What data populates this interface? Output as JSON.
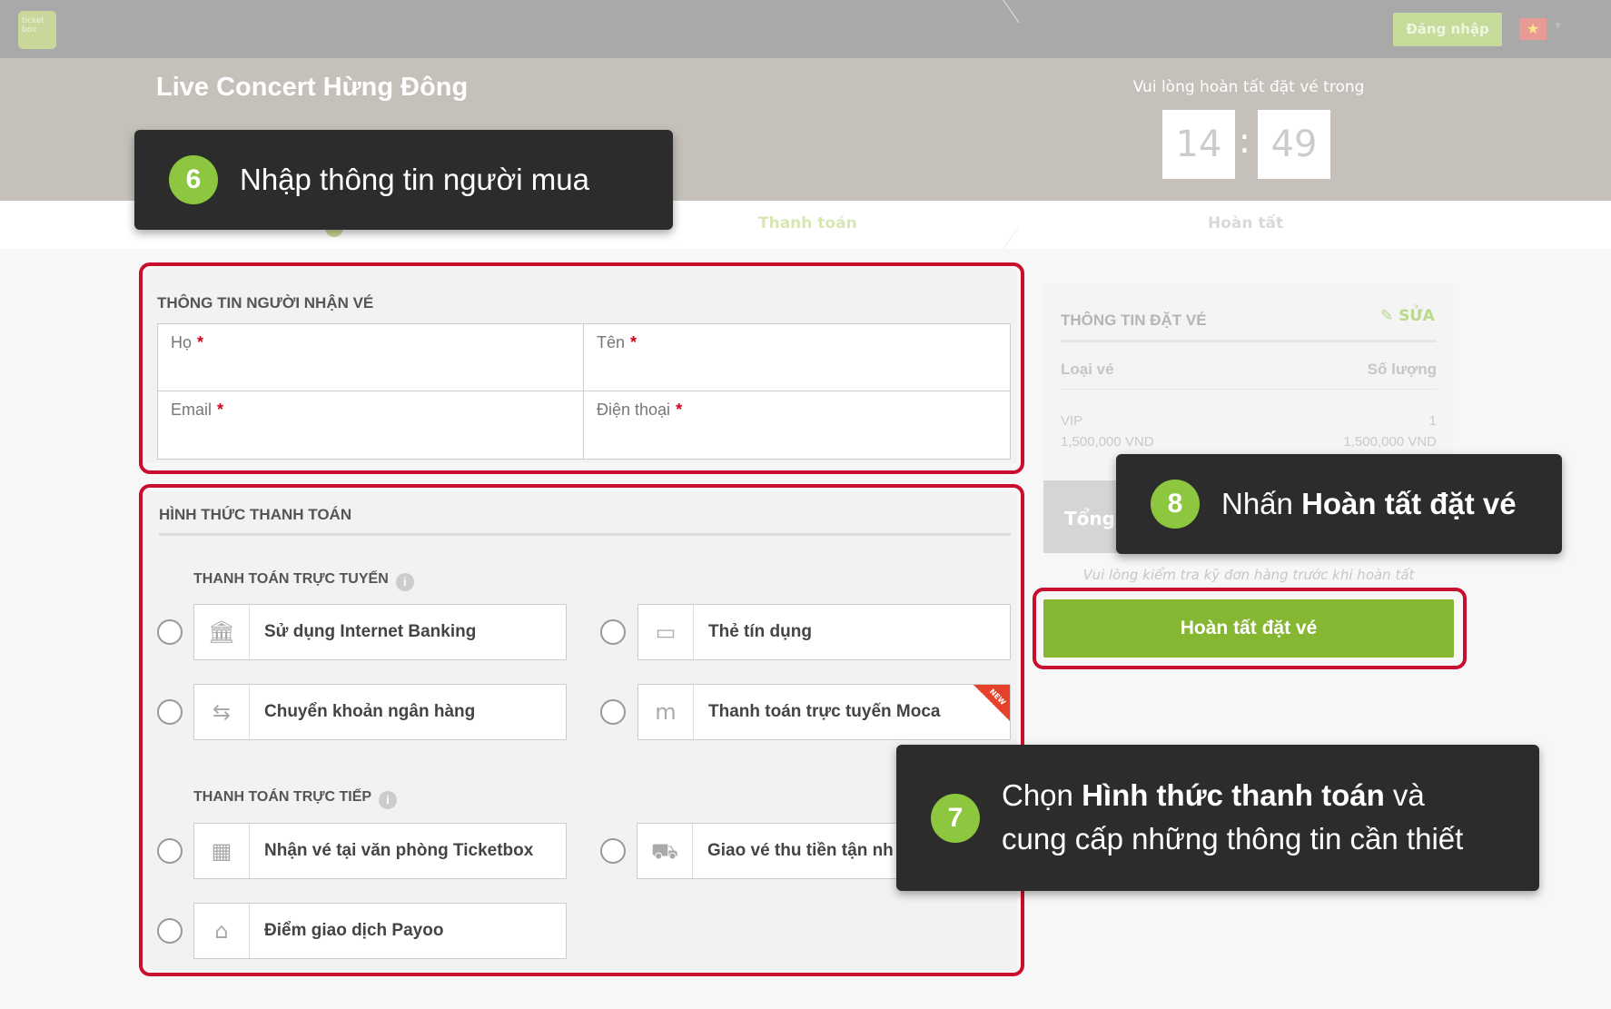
{
  "navbar": {
    "logo_text": "ticket box",
    "login_label": "Đăng nhập",
    "flag_icon": "vietnam-flag",
    "flag_symbol": "★"
  },
  "event": {
    "title": "Live Concert Hừng Đông",
    "timer_label": "Vui lòng hoàn tất đặt vé trong",
    "minutes": "14",
    "separator": ":",
    "seconds": "49"
  },
  "steps": [
    {
      "label": "Thanh toán"
    },
    {
      "label": "Hoàn tất"
    }
  ],
  "receiver": {
    "title": "THÔNG TIN NGƯỜI NHẬN VÉ",
    "fields": [
      {
        "label": "Họ",
        "required": "*"
      },
      {
        "label": "Tên",
        "required": "*"
      },
      {
        "label": "Email",
        "required": "*"
      },
      {
        "label": "Điện thoại",
        "required": "*"
      }
    ]
  },
  "payment": {
    "title": "HÌNH THỨC THANH TOÁN",
    "online_title": "THANH TOÁN TRỰC TUYẾN",
    "offline_title": "THANH TOÁN TRỰC TIẾP",
    "info_glyph": "i",
    "options": [
      {
        "label": "Sử dụng Internet Banking",
        "icon": "bank-icon",
        "glyph": "🏛"
      },
      {
        "label": "Thẻ tín dụng",
        "icon": "credit-card-icon",
        "glyph": "▭"
      },
      {
        "label": "Chuyển khoản ngân hàng",
        "icon": "transfer-icon",
        "glyph": "⇆"
      },
      {
        "label": "Thanh toán trực tuyến Moca",
        "icon": "moca-icon",
        "glyph": "m",
        "badge": "NEW"
      },
      {
        "label": "Nhận vé tại văn phòng Ticketbox",
        "icon": "building-icon",
        "glyph": "▦"
      },
      {
        "label": "Giao vé thu tiền tận nh",
        "icon": "truck-icon",
        "glyph": "⛟"
      },
      {
        "label": "Điểm giao dịch Payoo",
        "icon": "store-icon",
        "glyph": "⌂"
      }
    ]
  },
  "summary": {
    "title": "THÔNG TIN ĐẶT VÉ",
    "edit_label": "✎ SỬA",
    "col_type": "Loại vé",
    "col_qty": "Số lượng",
    "ticket_name": "VIP",
    "ticket_price": "1,500,000 VND",
    "ticket_qty": "1",
    "ticket_total": "1,500,000 VND",
    "total_label": "Tổng c",
    "check_note": "Vui lòng kiểm tra kỹ đơn hàng trước khi hoàn tất",
    "complete_label": "Hoàn tất đặt vé"
  },
  "callouts": {
    "step6": {
      "number": "6",
      "text": "Nhập thông tin người mua"
    },
    "step8": {
      "number": "8",
      "prefix": "Nhấn ",
      "bold": "Hoàn tất đặt vé"
    },
    "step7": {
      "number": "7",
      "prefix": "Chọn ",
      "bold": "Hình thức thanh toán",
      "suffix": " và",
      "line2": "cung cấp những thông tin cần thiết"
    }
  },
  "colors": {
    "accent_green": "#86b733",
    "badge_green": "#8dc63f",
    "highlight_red": "#c8102e",
    "callout_bg": "#2c2c2c"
  }
}
